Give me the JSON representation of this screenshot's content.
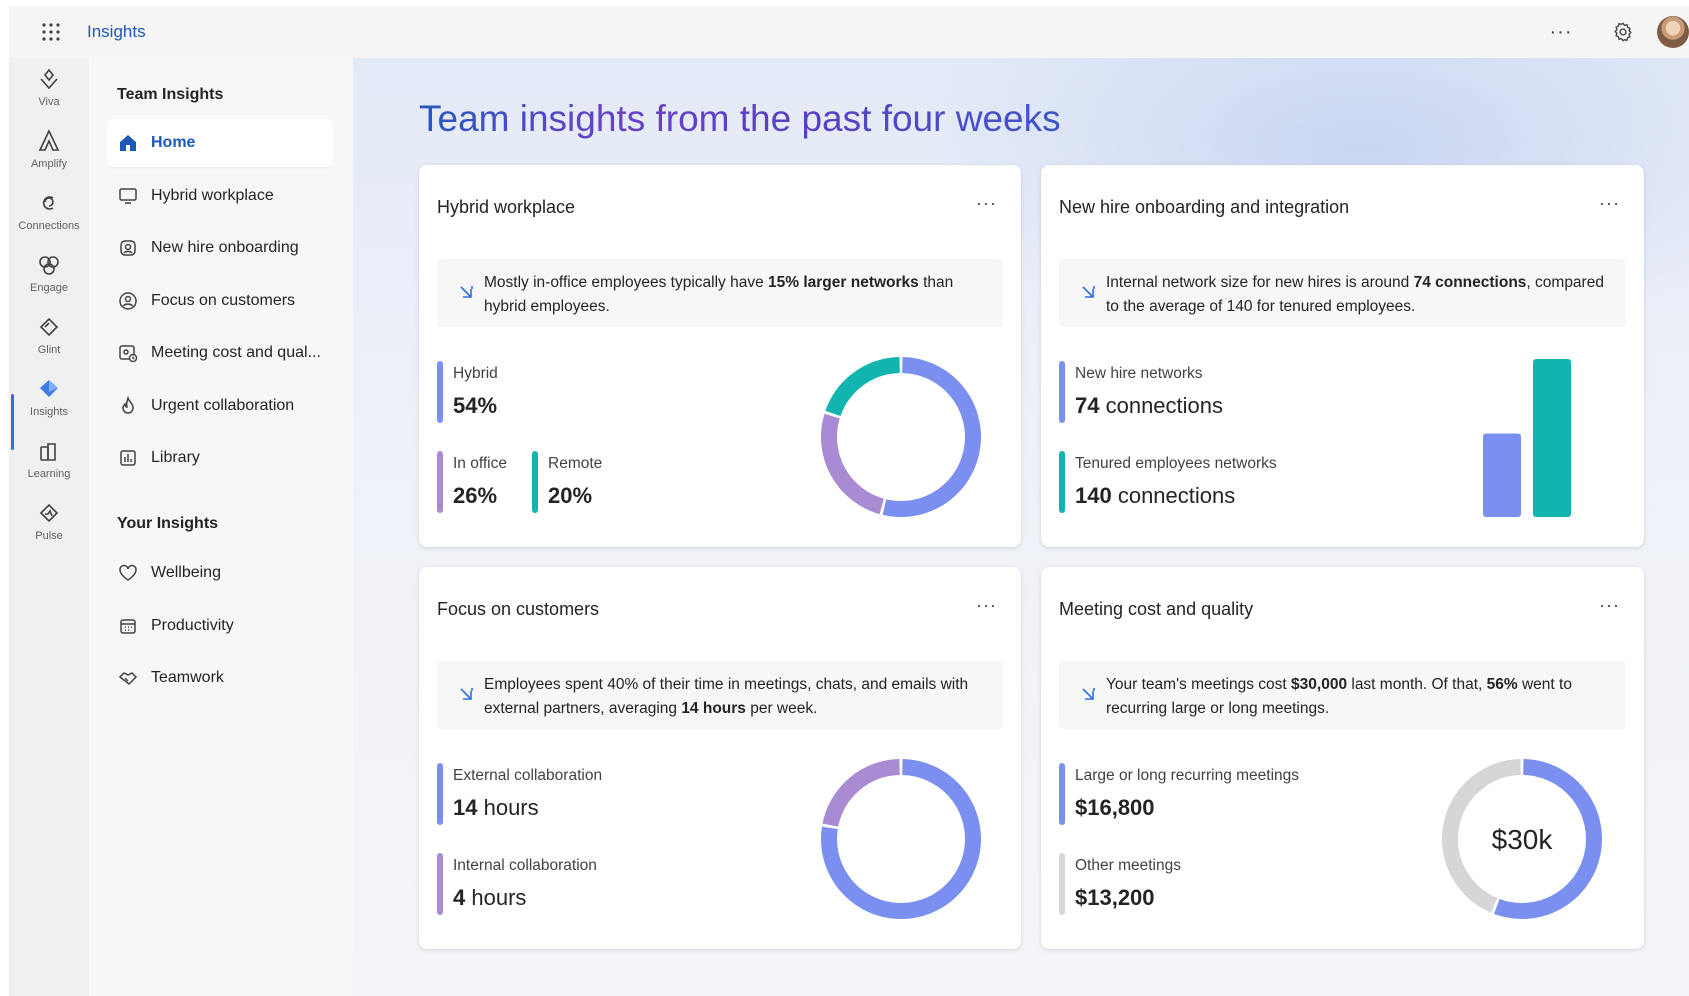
{
  "app": {
    "title": "Insights"
  },
  "topbar": {
    "more_label": "···"
  },
  "rail": {
    "items": [
      {
        "label": "Viva",
        "icon": "viva-icon"
      },
      {
        "label": "Amplify",
        "icon": "amplify-icon"
      },
      {
        "label": "Connections",
        "icon": "connections-icon"
      },
      {
        "label": "Engage",
        "icon": "engage-icon"
      },
      {
        "label": "Glint",
        "icon": "glint-icon"
      },
      {
        "label": "Insights",
        "icon": "insights-icon",
        "active": true
      },
      {
        "label": "Learning",
        "icon": "learning-icon"
      },
      {
        "label": "Pulse",
        "icon": "pulse-icon"
      }
    ]
  },
  "nav": {
    "team_heading": "Team Insights",
    "team_items": [
      {
        "label": "Home",
        "icon": "home-icon",
        "active": true
      },
      {
        "label": "Hybrid workplace",
        "icon": "monitor-icon"
      },
      {
        "label": "New hire onboarding",
        "icon": "badge-icon"
      },
      {
        "label": "Focus on customers",
        "icon": "customer-icon"
      },
      {
        "label": "Meeting cost and qual...",
        "icon": "meeting-icon"
      },
      {
        "label": "Urgent collaboration",
        "icon": "flame-icon"
      },
      {
        "label": "Library",
        "icon": "library-icon"
      }
    ],
    "your_heading": "Your Insights",
    "your_items": [
      {
        "label": "Wellbeing",
        "icon": "heart-icon"
      },
      {
        "label": "Productivity",
        "icon": "calendar-icon"
      },
      {
        "label": "Teamwork",
        "icon": "handshake-icon"
      }
    ]
  },
  "main": {
    "title": "Team insights from the past four weeks",
    "cards": {
      "hybrid": {
        "title": "Hybrid workplace",
        "more": "···",
        "callout": {
          "pre": "Mostly in-office employees typically have ",
          "bold": "15% larger networks",
          "post": " than hybrid employees."
        },
        "metrics": {
          "hybrid": {
            "label": "Hybrid",
            "value": "54%"
          },
          "office": {
            "label": "In office",
            "value": "26%"
          },
          "remote": {
            "label": "Remote",
            "value": "20%"
          }
        }
      },
      "newhire": {
        "title": "New hire onboarding and integration",
        "more": "···",
        "callout": {
          "pre": "Internal network size for new hires is around ",
          "bold": "74 connections",
          "post": ", compared to the average of 140 for tenured employees."
        },
        "metrics": {
          "newhire": {
            "label": "New hire networks",
            "num": "74",
            "unit": " connections"
          },
          "tenured": {
            "label": "Tenured employees networks",
            "num": "140",
            "unit": " connections"
          }
        }
      },
      "customers": {
        "title": "Focus on customers",
        "more": "···",
        "callout": {
          "pre": "Employees spent 40% of their time in meetings, chats, and emails with external partners, averaging ",
          "bold": "14 hours",
          "post": " per week."
        },
        "metrics": {
          "external": {
            "label": "External collaboration",
            "num": "14",
            "unit": " hours"
          },
          "internal": {
            "label": "Internal collaboration",
            "num": "4",
            "unit": " hours"
          }
        }
      },
      "meeting": {
        "title": "Meeting cost and quality",
        "more": "···",
        "callout": {
          "pre": "Your team's meetings cost ",
          "bold": "$30,000",
          "mid": " last month. Of that, ",
          "bold2": "56%",
          "post": " went to recurring large or long meetings."
        },
        "metrics": {
          "large": {
            "label": "Large or long recurring meetings",
            "value": "$16,800"
          },
          "other": {
            "label": "Other meetings",
            "value": "$13,200"
          }
        },
        "center_label": "$30k"
      }
    }
  },
  "colors": {
    "blue": "#7b8ff0",
    "purple": "#a98bd3",
    "teal": "#12b4b0",
    "gray": "#d6d6d6",
    "accent": "#1b58b8"
  },
  "chart_data": [
    {
      "type": "pie",
      "categories": [
        "Hybrid",
        "In office",
        "Remote"
      ],
      "values": [
        54,
        26,
        20
      ],
      "donut": true
    },
    {
      "type": "bar",
      "categories": [
        "New hire networks",
        "Tenured employees networks"
      ],
      "values": [
        74,
        140
      ]
    },
    {
      "type": "pie",
      "categories": [
        "External collaboration",
        "Internal collaboration"
      ],
      "values": [
        14,
        4
      ],
      "donut": true
    },
    {
      "type": "pie",
      "categories": [
        "Large or long recurring meetings",
        "Other meetings"
      ],
      "values": [
        16800,
        13200
      ],
      "donut": true,
      "center_label": "$30k"
    }
  ]
}
